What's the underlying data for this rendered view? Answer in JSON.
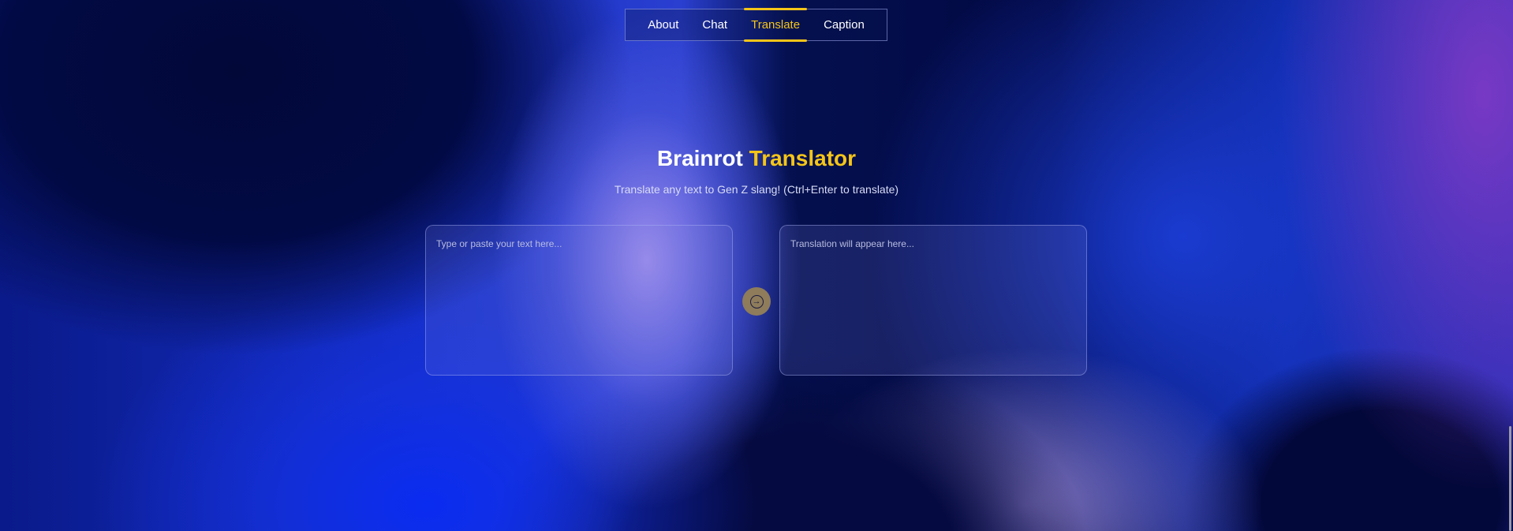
{
  "nav": {
    "items": [
      {
        "label": "About",
        "active": false
      },
      {
        "label": "Chat",
        "active": false
      },
      {
        "label": "Translate",
        "active": true
      },
      {
        "label": "Caption",
        "active": false
      }
    ]
  },
  "header": {
    "title_main": "Brainrot",
    "title_accent": "Translator",
    "subtitle": "Translate any text to Gen Z slang! (Ctrl+Enter to translate)"
  },
  "input": {
    "placeholder": "Type or paste your text here...",
    "value": ""
  },
  "output": {
    "placeholder": "Translation will appear here..."
  },
  "translate_button": {
    "icon": "arrow-right-circle-icon",
    "glyph": "→"
  },
  "colors": {
    "accent": "#f5c518",
    "button": "#8e7c5b"
  }
}
